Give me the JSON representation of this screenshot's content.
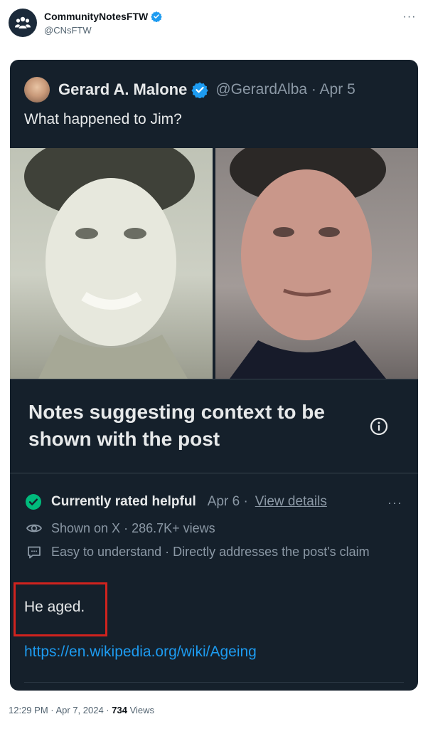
{
  "post": {
    "author_name": "CommunityNotesFTW",
    "author_handle": "@CNsFTW",
    "more_label": "···"
  },
  "quoted": {
    "author_name": "Gerard A. Malone",
    "handle_date": "@GerardAlba · Apr 5",
    "text": "What happened to Jim?"
  },
  "notes": {
    "title": "Notes suggesting context to be shown with the post",
    "rating_label": "Currently rated helpful",
    "rating_date": "Apr 6 ·",
    "view_details": "View details",
    "shown_on": "Shown on X · 286.7K+ views",
    "reason": "Easy to understand · Directly addresses the post's claim",
    "body": "He aged.",
    "link": "https://en.wikipedia.org/wiki/Ageing",
    "more_label": "···"
  },
  "footer": {
    "time_date": "12:29 PM · Apr 7, 2024 · ",
    "views_count": "734",
    "views_label": " Views"
  },
  "colors": {
    "verified_blue": "#1d9bf0",
    "helpful_green": "#00ba7c",
    "highlight_red": "#d0231e",
    "card_bg": "#15202b"
  },
  "icons": [
    "community-notes-logo-icon",
    "verified-badge-icon",
    "info-icon",
    "check-circle-icon",
    "eye-icon",
    "comment-icon"
  ]
}
